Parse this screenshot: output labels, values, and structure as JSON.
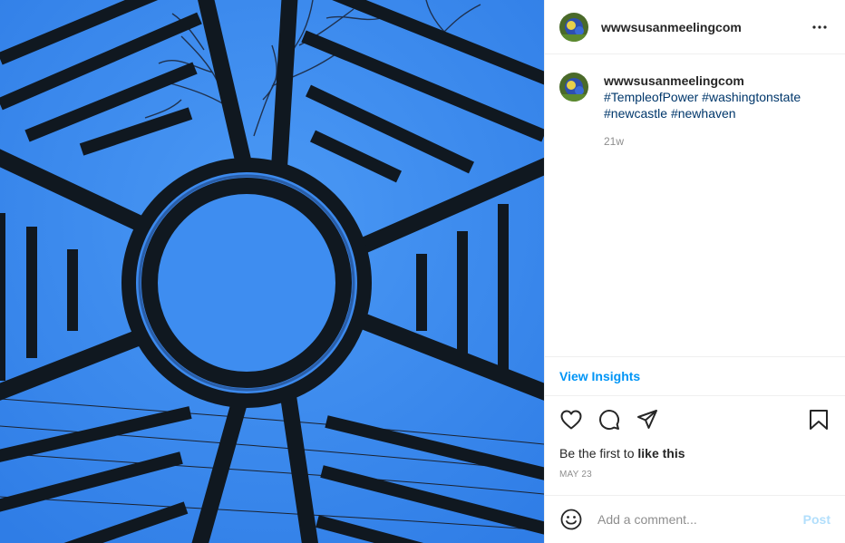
{
  "post": {
    "username": "wwwsusanmeelingcom",
    "caption": {
      "username": "wwwsusanmeelingcom",
      "hashtags": [
        "#TempleofPower",
        "#washingtonstate",
        "#newcastle",
        "#newhaven"
      ]
    },
    "age": "21w",
    "view_insights": "View Insights",
    "likes": {
      "prefix": "Be the first to ",
      "bold": "like this"
    },
    "date": "MAY 23",
    "comment": {
      "placeholder": "Add a comment...",
      "post_label": "Post"
    }
  },
  "icons": {
    "more": "more-options-icon",
    "like": "heart-icon",
    "comment": "comment-icon",
    "share": "paper-plane-icon",
    "save": "bookmark-icon",
    "emoji": "smiley-icon"
  },
  "colors": {
    "sky": "#3f8ff0",
    "link": "#00376b",
    "insights": "#0095f6",
    "post_disabled": "#b2dffc",
    "muted": "#8e8e8e"
  }
}
